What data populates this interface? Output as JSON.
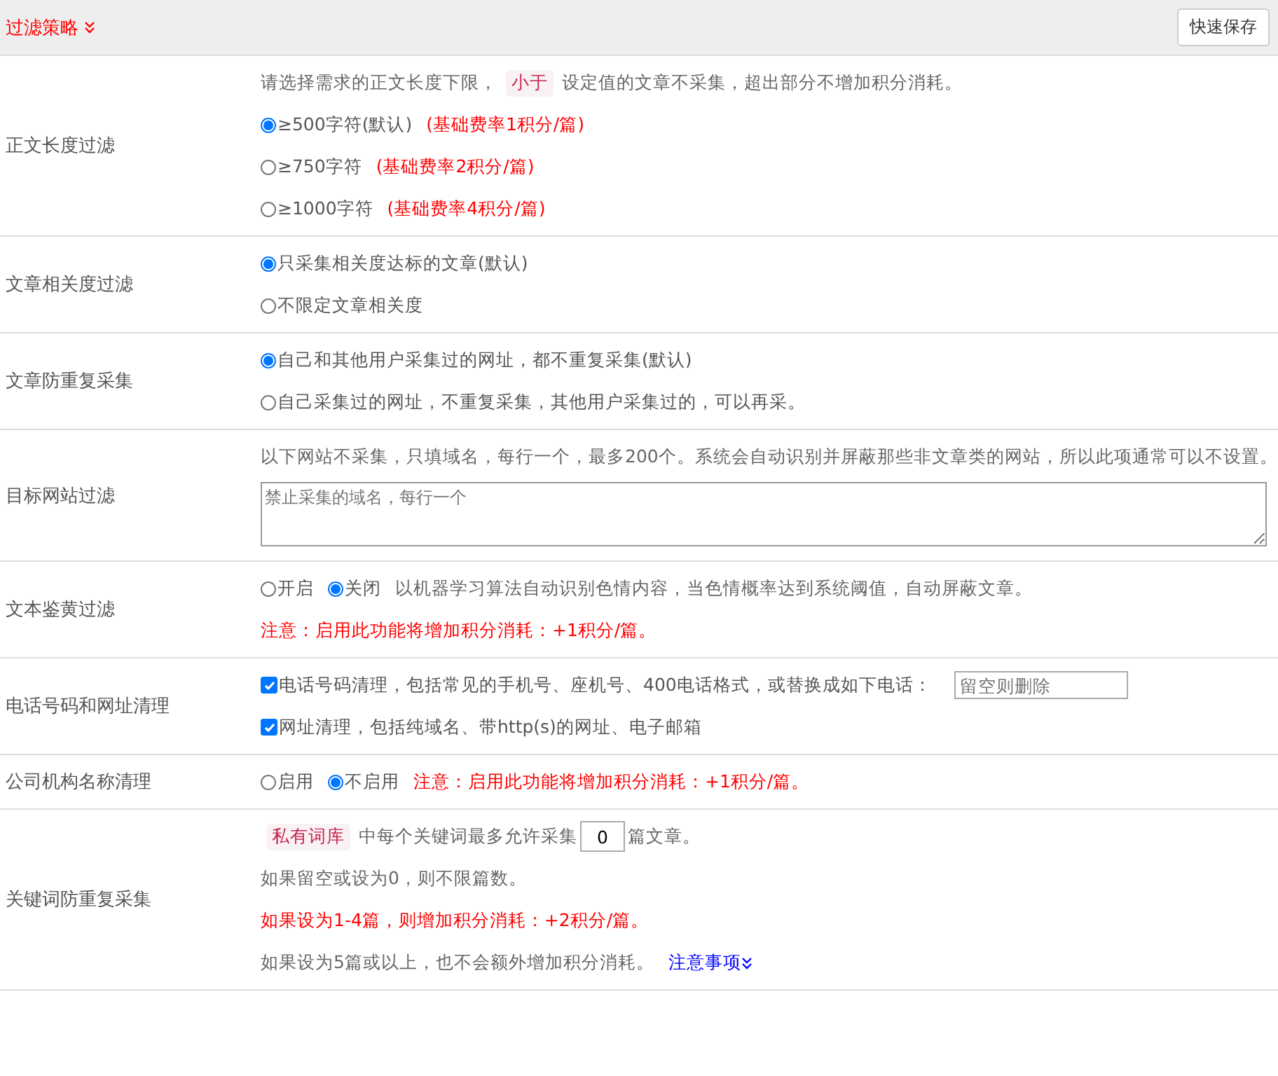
{
  "header": {
    "title": "过滤策略",
    "save_button": "快速保存"
  },
  "rows": [
    {
      "label": "正文长度过滤",
      "lines": [
        [
          {
            "kind": "text",
            "text": "请选择需求的正文长度下限，"
          },
          {
            "kind": "tag",
            "text": "小于"
          },
          {
            "kind": "text",
            "text": "设定值的文章不采集，超出部分不增加积分消耗。"
          }
        ],
        [
          {
            "kind": "radio",
            "text": "≥500字符(默认)",
            "selected": true
          },
          {
            "kind": "warn",
            "text": "(基础费率1积分/篇)"
          }
        ],
        [
          {
            "kind": "radio",
            "text": "≥750字符",
            "selected": false
          },
          {
            "kind": "warn",
            "text": "(基础费率2积分/篇)"
          }
        ],
        [
          {
            "kind": "radio",
            "text": "≥1000字符",
            "selected": false
          },
          {
            "kind": "warn",
            "text": "(基础费率4积分/篇)"
          }
        ]
      ]
    },
    {
      "label": "文章相关度过滤",
      "lines": [
        [
          {
            "kind": "radio",
            "text": "只采集相关度达标的文章(默认)",
            "selected": true
          }
        ],
        [
          {
            "kind": "radio",
            "text": "不限定文章相关度",
            "selected": false
          }
        ]
      ]
    },
    {
      "label": "文章防重复采集",
      "lines": [
        [
          {
            "kind": "radio",
            "text": "自己和其他用户采集过的网址，都不重复采集(默认)",
            "selected": true
          }
        ],
        [
          {
            "kind": "radio",
            "text": "自己采集过的网址，不重复采集，其他用户采集过的，可以再采。",
            "selected": false
          }
        ]
      ]
    },
    {
      "label": "目标网站过滤",
      "lines": [
        [
          {
            "kind": "text",
            "text": "以下网站不采集，只填域名，每行一个，最多200个。系统会自动识别并屏蔽那些非文章类的网站，所以此项通常可以不设置。"
          }
        ],
        [
          {
            "kind": "textarea",
            "placeholder": "禁止采集的域名，每行一个"
          }
        ]
      ]
    },
    {
      "label": "文本鉴黄过滤",
      "lines": [
        [
          {
            "kind": "radio",
            "text": "开启",
            "selected": false
          },
          {
            "kind": "radio",
            "text": "关闭",
            "selected": true
          },
          {
            "kind": "text",
            "text": "以机器学习算法自动识别色情内容，当色情概率达到系统阈值，自动屏蔽文章。"
          }
        ],
        [
          {
            "kind": "warn",
            "text": "注意：启用此功能将增加积分消耗：+1积分/篇。"
          }
        ]
      ]
    },
    {
      "label": "电话号码和网址清理",
      "lines": [
        [
          {
            "kind": "checkbox",
            "text": "电话号码清理，包括常见的手机号、座机号、400电话格式，或替换成如下电话：",
            "checked": true
          },
          {
            "kind": "input",
            "placeholder": "留空则删除"
          }
        ],
        [
          {
            "kind": "checkbox",
            "text": "网址清理，包括纯域名、带http(s)的网址、电子邮箱",
            "checked": true
          }
        ]
      ]
    },
    {
      "label": "公司机构名称清理",
      "lines": [
        [
          {
            "kind": "radio",
            "text": "启用",
            "selected": false
          },
          {
            "kind": "radio",
            "text": "不启用",
            "selected": true
          },
          {
            "kind": "warn",
            "text": "注意：启用此功能将增加积分消耗：+1积分/篇。"
          }
        ]
      ]
    },
    {
      "label": "关键词防重复采集",
      "lines": [
        [
          {
            "kind": "tag",
            "text": "私有词库"
          },
          {
            "kind": "text",
            "text": "中每个关键词最多允许采集"
          },
          {
            "kind": "number",
            "value": "0"
          },
          {
            "kind": "text",
            "text": "篇文章。"
          }
        ],
        [
          {
            "kind": "text",
            "text": "如果留空或设为0，则不限篇数。"
          }
        ],
        [
          {
            "kind": "warn",
            "text": "如果设为1-4篇，则增加积分消耗：+2积分/篇。"
          }
        ],
        [
          {
            "kind": "text",
            "text": "如果设为5篇或以上，也不会额外增加积分消耗。"
          },
          {
            "kind": "link",
            "text": "注意事项"
          }
        ]
      ]
    }
  ]
}
